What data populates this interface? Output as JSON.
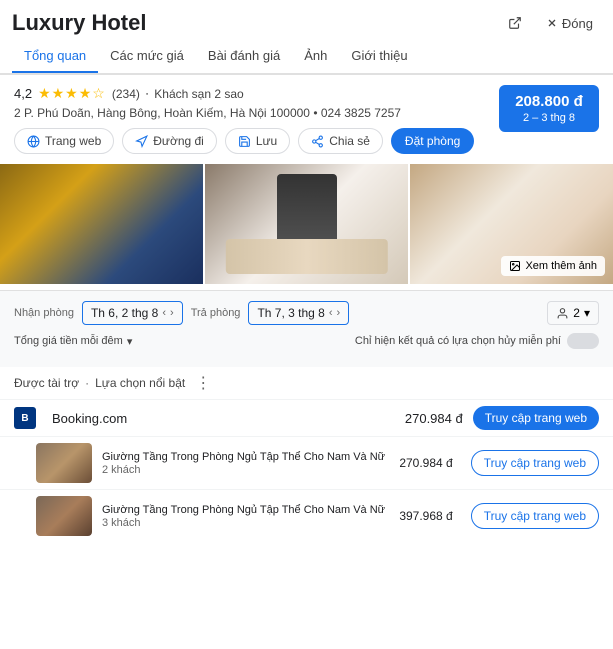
{
  "header": {
    "title": "Luxury Hotel",
    "open_label": "Mở",
    "close_label": "Đóng"
  },
  "tabs": [
    {
      "id": "overview",
      "label": "Tổng quan",
      "active": true
    },
    {
      "id": "prices",
      "label": "Các mức giá",
      "active": false
    },
    {
      "id": "reviews",
      "label": "Bài đánh giá",
      "active": false
    },
    {
      "id": "photos",
      "label": "Ảnh",
      "active": false
    },
    {
      "id": "about",
      "label": "Giới thiệu",
      "active": false
    }
  ],
  "hotel": {
    "rating": "4,2",
    "stars": "★★★★☆",
    "review_count": "(234)",
    "type": "Khách sạn 2 sao",
    "address": "2 P. Phú Doãn, Hàng Bông, Hoàn Kiếm, Hà Nội 100000",
    "phone": "024 3825 7257",
    "price": "208.800 đ",
    "price_dates": "2 – 3 thg 8"
  },
  "action_buttons": [
    {
      "id": "web",
      "label": "Trang web",
      "icon": "globe"
    },
    {
      "id": "directions",
      "label": "Đường đi",
      "icon": "directions"
    },
    {
      "id": "save",
      "label": "Lưu",
      "icon": "save"
    },
    {
      "id": "share",
      "label": "Chia sẻ",
      "icon": "share"
    }
  ],
  "book_button": "Đặt phòng",
  "see_more": "Xem thêm ảnh",
  "booking_form": {
    "checkin_label": "Nhận phòng",
    "checkout_label": "Trả phòng",
    "checkin_date": "Th 6, 2 thg 8",
    "checkout_date": "Th 7, 3 thg 8",
    "guests": "2",
    "price_toggle": "Tổng giá tiền mỗi đêm",
    "free_cancel": "Chỉ hiện kết quả có lựa chọn hủy miễn phí"
  },
  "featured": {
    "label": "Được tài trợ",
    "sublabel": "Lựa chọn nổi bật"
  },
  "providers": [
    {
      "name": "Booking.com",
      "logo": "B",
      "price": "270.984 đ",
      "button": "Truy cập trang web",
      "button_type": "primary"
    }
  ],
  "rooms": [
    {
      "name": "Giường Tầng Trong Phòng Ngủ Tập Thể Cho Nam Và Nữ",
      "guests": "2 khách",
      "price": "270.984 đ",
      "button": "Truy cập trang web",
      "button_type": "outline"
    },
    {
      "name": "Giường Tầng Trong Phòng Ngủ Tập Thể Cho Nam Và Nữ",
      "guests": "3 khách",
      "price": "397.968 đ",
      "button": "Truy cập trang web",
      "button_type": "outline"
    }
  ]
}
